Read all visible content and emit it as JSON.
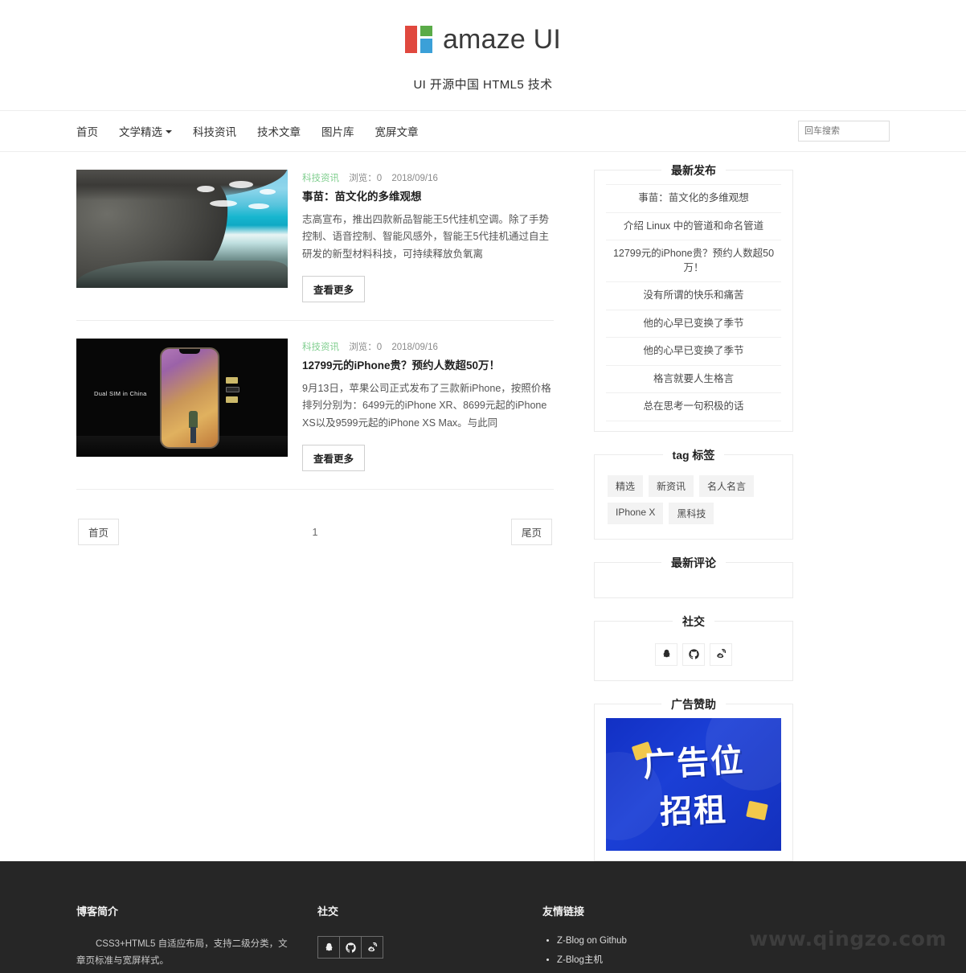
{
  "header": {
    "logo_text": "amaze UI",
    "logo_colors": {
      "red": "#e0483e",
      "green": "#5aab48",
      "blue": "#3ba0d8"
    },
    "subtitle": "UI 开源中国 HTML5 技术"
  },
  "nav": {
    "items": [
      {
        "label": "首页",
        "has_caret": false
      },
      {
        "label": "文学精选",
        "has_caret": true
      },
      {
        "label": "科技资讯",
        "has_caret": false
      },
      {
        "label": "技术文章",
        "has_caret": false
      },
      {
        "label": "图片库",
        "has_caret": false
      },
      {
        "label": "宽屏文章",
        "has_caret": false
      }
    ],
    "search": {
      "placeholder": "回车搜索",
      "value": ""
    }
  },
  "articles": [
    {
      "category": "科技资讯",
      "views_label": "浏览：0",
      "date": "2018/09/16",
      "title": "事苗：苗文化的多维观想",
      "excerpt": "志高宣布，推出四款新品智能王5代挂机空调。除了手势控制、语音控制、智能风感外，智能王5代挂机通过自主研发的新型材料科技，可持续释放负氧离",
      "button": "查看更多",
      "thumb": "beach-cave-photo",
      "thumb_caption": ""
    },
    {
      "category": "科技资讯",
      "views_label": "浏览：0",
      "date": "2018/09/16",
      "title": "12799元的iPhone贵？预约人数超50万！",
      "excerpt": "9月13日，苹果公司正式发布了三款新iPhone，按照价格排列分别为：6499元的iPhone XR、8699元起的iPhone XS以及9599元起的iPhone XS Max。与此同",
      "button": "查看更多",
      "thumb": "apple-keynote-photo",
      "thumb_caption": "Dual SIM in China"
    }
  ],
  "pagination": {
    "first_label": "首页",
    "current_page": "1",
    "last_label": "尾页"
  },
  "sidebar": {
    "latest_posts": {
      "title": "最新发布",
      "items": [
        "事苗：苗文化的多维观想",
        "介绍 Linux 中的管道和命名管道",
        "12799元的iPhone贵？预约人数超50万！",
        "没有所谓的快乐和痛苦",
        "他的心早已变换了季节",
        "他的心早已变换了季节",
        "格言就要人生格言",
        "总在思考一句积极的话"
      ]
    },
    "tags": {
      "title": "tag 标签",
      "items": [
        "精选",
        "新资讯",
        "名人名言",
        "IPhone X",
        "黑科技"
      ]
    },
    "comments": {
      "title": "最新评论",
      "items": []
    },
    "social": {
      "title": "社交",
      "items": [
        {
          "icon": "qq-icon",
          "label": "QQ"
        },
        {
          "icon": "github-icon",
          "label": "Github"
        },
        {
          "icon": "weibo-icon",
          "label": "微博"
        }
      ]
    },
    "ad": {
      "title": "广告赞助",
      "banner_line1": "广告位",
      "banner_line2": "招租",
      "banner_bg": "#1330bd"
    }
  },
  "footer": {
    "about": {
      "title": "博客简介",
      "desc": "CSS3+HTML5 自适应布局，支持二级分类，文章页标准与宽屏样式。"
    },
    "social": {
      "title": "社交",
      "items": [
        {
          "icon": "qq-icon",
          "label": "QQ"
        },
        {
          "icon": "github-icon",
          "label": "Github"
        },
        {
          "icon": "weibo-icon",
          "label": "微博"
        }
      ]
    },
    "links": {
      "title": "友情链接",
      "items": [
        "Z-Blog on Github",
        "Z-Blog主机"
      ]
    },
    "watermark": "www.qingzo.com"
  }
}
